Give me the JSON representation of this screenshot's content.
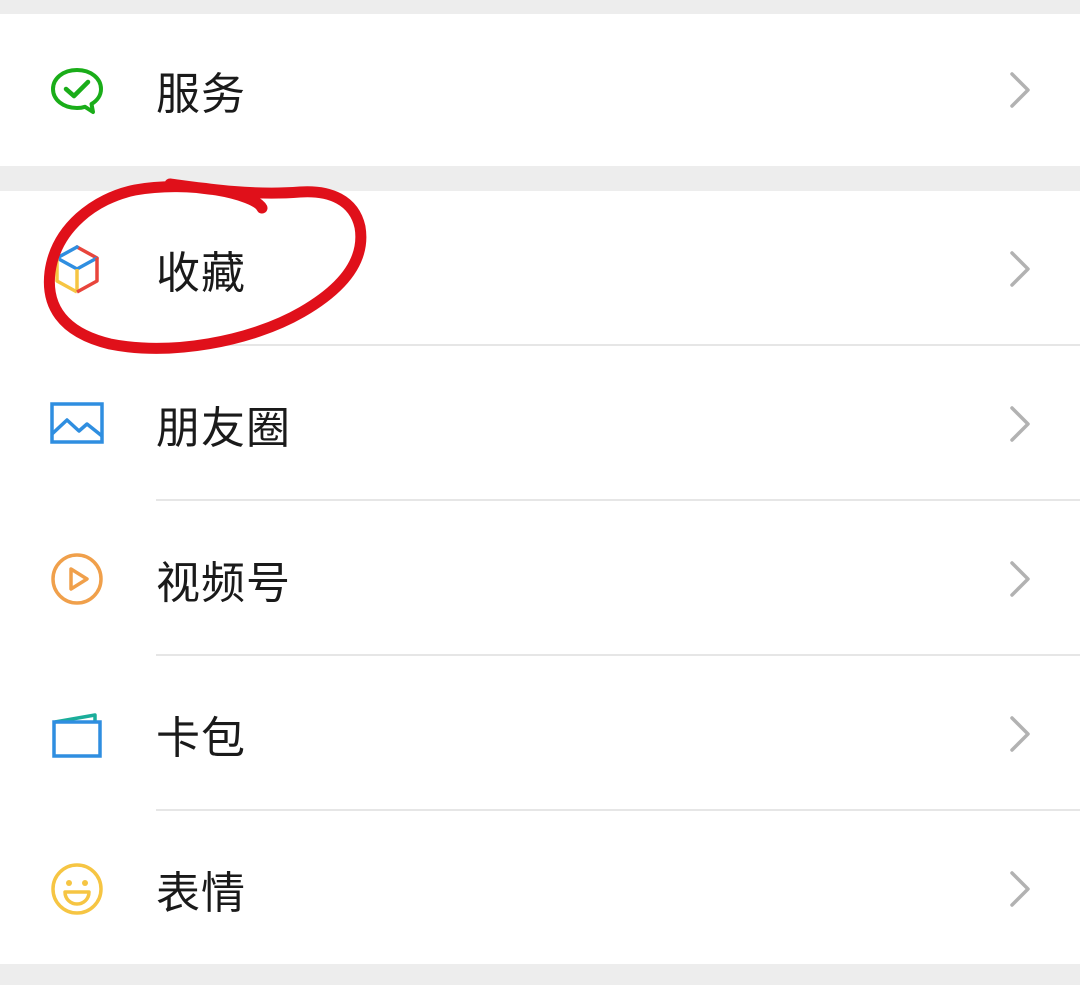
{
  "menu": {
    "services": {
      "label": "服务",
      "icon": "wechat-pay-icon"
    },
    "items": [
      {
        "label": "收藏",
        "icon": "favorites-cube-icon"
      },
      {
        "label": "朋友圈",
        "icon": "moments-picture-icon"
      },
      {
        "label": "视频号",
        "icon": "channels-play-icon"
      },
      {
        "label": "卡包",
        "icon": "card-wallet-icon"
      },
      {
        "label": "表情",
        "icon": "sticker-smile-icon"
      }
    ]
  },
  "colors": {
    "background": "#ededed",
    "row_background": "#ffffff",
    "text": "#1a1a1a",
    "chevron": "#b2b2b2",
    "services_green": "#1aad19",
    "moments_blue": "#2f8ee0",
    "channels_orange": "#f0a04b",
    "wallet_blue": "#2f8ee0",
    "sticker_yellow": "#f6c543",
    "annotation_red": "#e0101a"
  }
}
